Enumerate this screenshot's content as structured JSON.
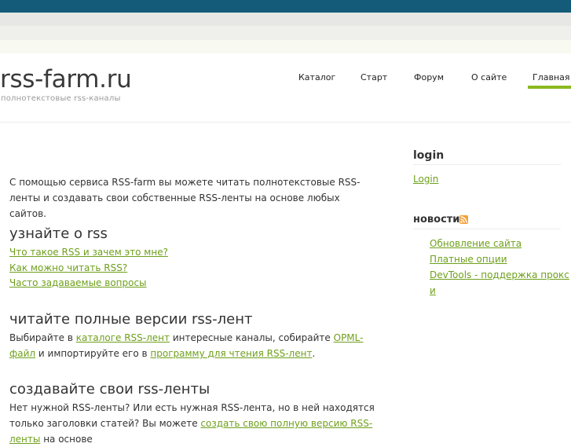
{
  "header": {
    "logo": "rss-farm.ru",
    "slogan": "полнотекстовые rss-каналы",
    "nav": [
      "Каталог",
      "Старт",
      "Форум",
      "О сайте",
      "Главная"
    ]
  },
  "main": {
    "intro": "С помощью сервиса RSS-farm вы можете читать полнотекстовые RSS-ленты и создавать свои собственные RSS-ленты на основе любых сайтов.",
    "sec1": {
      "title": "узнайте о rss",
      "links": [
        "Что такое RSS и зачем это мне?",
        "Как можно читать RSS?",
        "Часто задаваемые вопросы"
      ]
    },
    "sec2": {
      "title": "читайте полные версии rss-лент",
      "t1": "Выбирайте в ",
      "l1": "каталоге RSS-лент",
      "t2": " интересные каналы, собирайте ",
      "l2": "OPML-файл",
      "t3": " и импортируйте его в ",
      "l3": "программу для чтения RSS-лент",
      "t4": "."
    },
    "sec3": {
      "title": "создавайте свои rss-ленты",
      "t1": "Нет нужной RSS-ленты? Или есть нужная RSS-лента, но в ней находятся только заголовки статей? Вы можете ",
      "l1": "создать свою полную версию RSS-ленты",
      "t2": " на основе"
    }
  },
  "sidebar": {
    "login_title": "login",
    "login_link": "Login",
    "news_title": "новости",
    "news_icon": "rss-feed-icon",
    "news_links": [
      "Обновление сайта",
      "Платные опции",
      "DevTools - поддержка прокс",
      "и"
    ]
  },
  "colors": {
    "top_bar": "#145a79",
    "accent": "#8ab91f",
    "link": "#6fa01c"
  }
}
